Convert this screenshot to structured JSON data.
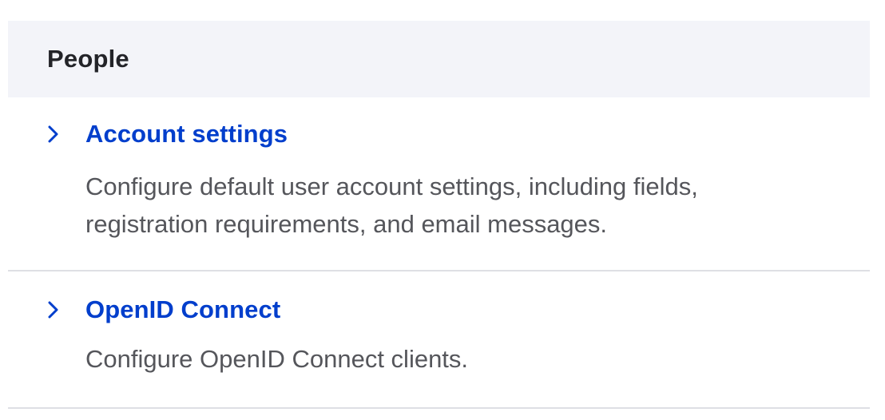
{
  "section": {
    "title": "People",
    "items": [
      {
        "label": "Account settings",
        "description_line1": "Configure default user account settings, including fields,",
        "description_line2": "registration requirements, and email messages.",
        "icon": "chevron-right-icon"
      },
      {
        "label": "OpenID Connect",
        "description_line1": "Configure OpenID Connect clients.",
        "icon": "chevron-right-icon"
      }
    ]
  },
  "colors": {
    "link": "#003ecc",
    "header_bg": "#f3f4f9",
    "title_text": "#232429",
    "description_text": "#55565b",
    "divider": "#dedfe4"
  }
}
